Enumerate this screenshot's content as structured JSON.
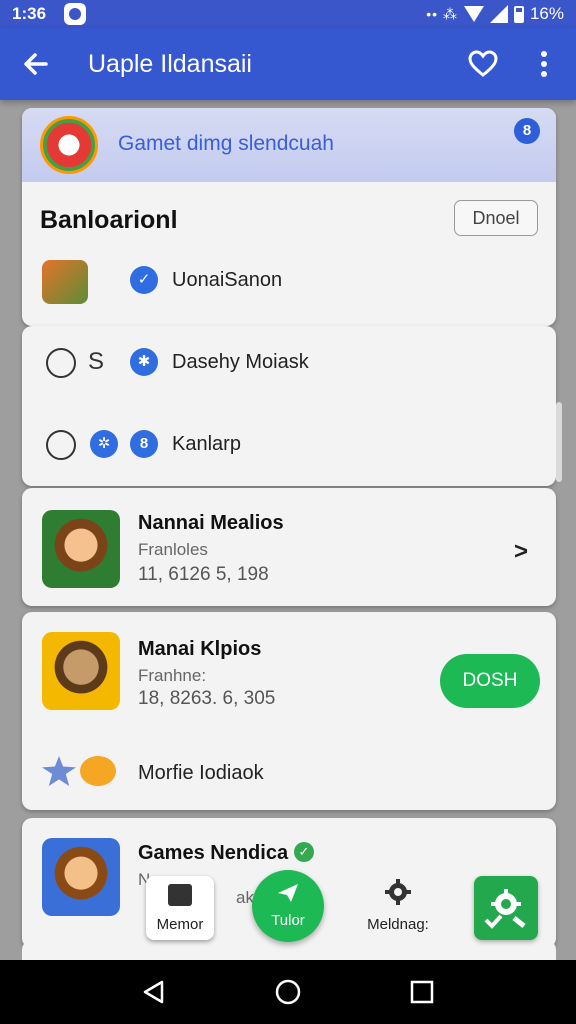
{
  "status": {
    "time": "1:36",
    "battery": "16%"
  },
  "appbar": {
    "title": "Uaple Ildansaii"
  },
  "banner": {
    "text": "Gamet dimg slendcuah",
    "chat_badge": "8"
  },
  "section": {
    "title": "Banloarionl",
    "done_label": "Dnoel"
  },
  "list_items": [
    {
      "label": "UonaiSanon"
    },
    {
      "label": "Dasehy Moiask",
      "prefix": "S"
    },
    {
      "label": "Kanlarp"
    }
  ],
  "games": [
    {
      "name": "Nannai Mealios",
      "sub": "Franloles",
      "nums": "11, 6126 5, 198"
    },
    {
      "name": "Manai Klpios",
      "sub": "Franhne:",
      "nums": "18, 8263. 6, 305",
      "action": "DOSH",
      "extra_label": "Morfie Iodiaok"
    },
    {
      "name": "Games Nendica",
      "sub_a": "N",
      "sub_b": "ako"
    }
  ],
  "bottom": {
    "memor_label": "Memor",
    "green_label": "Tulor",
    "settings_label": "Meldnag:"
  },
  "colors": {
    "primary": "#3557d0",
    "accent_green": "#1db954",
    "badge_blue": "#2f6de0"
  }
}
